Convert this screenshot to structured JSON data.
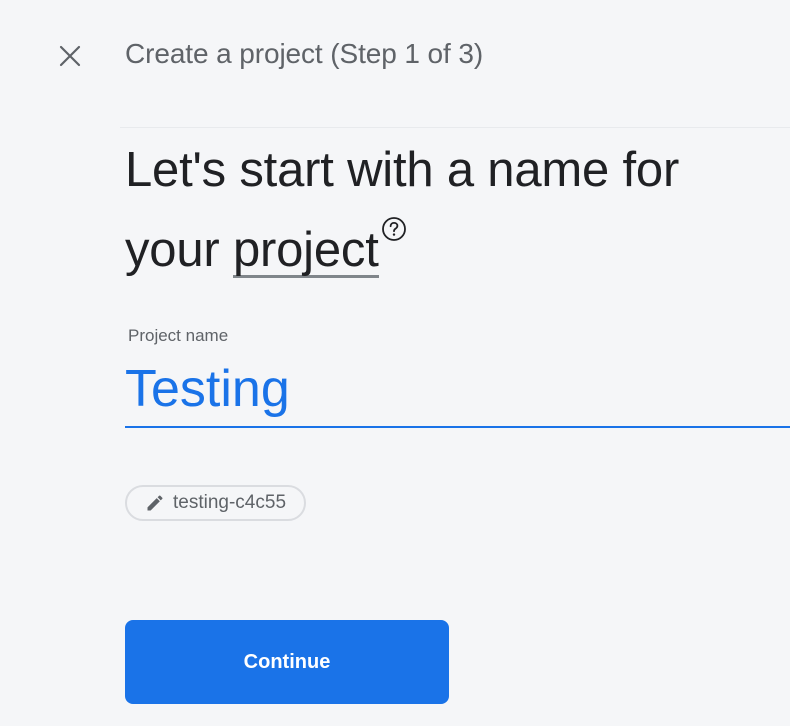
{
  "header": {
    "close_icon": "close-icon",
    "step_title": "Create a project (Step 1 of 3)"
  },
  "heading": {
    "line1": "Let's start with a name for",
    "line2_prefix": "your ",
    "help_term": "project",
    "help_icon": "help-circle-icon"
  },
  "form": {
    "project_name_label": "Project name",
    "project_name_value": "Testing",
    "project_id": "testing-c4c55",
    "project_id_icon": "pencil-icon"
  },
  "actions": {
    "continue_label": "Continue"
  },
  "colors": {
    "accent": "#1a73e8",
    "background": "#f5f6f8",
    "text_primary": "#202124",
    "text_secondary": "#5f6368"
  }
}
